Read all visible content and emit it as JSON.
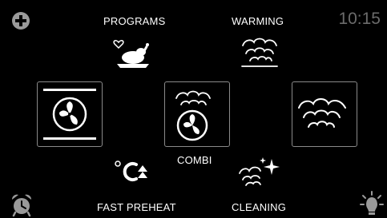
{
  "clock": {
    "time": "10:15"
  },
  "menu": {
    "programs_label": "PROGRAMS",
    "warming_label": "WARMING",
    "combi_label": "COMBI",
    "fast_preheat_label": "FAST PREHEAT",
    "cleaning_label": "CLEANING"
  },
  "icons": {
    "add": "plus-icon",
    "programs": "roast-chicken-icon",
    "warming": "steam-icon",
    "fan": "fan-icon",
    "combi": "steam-fan-icon",
    "steam": "steam-icon",
    "fast_preheat": "fast-preheat-icon",
    "cleaning": "sparkle-steam-icon",
    "alarm": "alarm-clock-icon",
    "light": "oven-light-icon"
  },
  "colors": {
    "background": "#000000",
    "foreground": "#ffffff",
    "clock": "#6b6b6b",
    "tile_border": "#8a8a8a"
  }
}
